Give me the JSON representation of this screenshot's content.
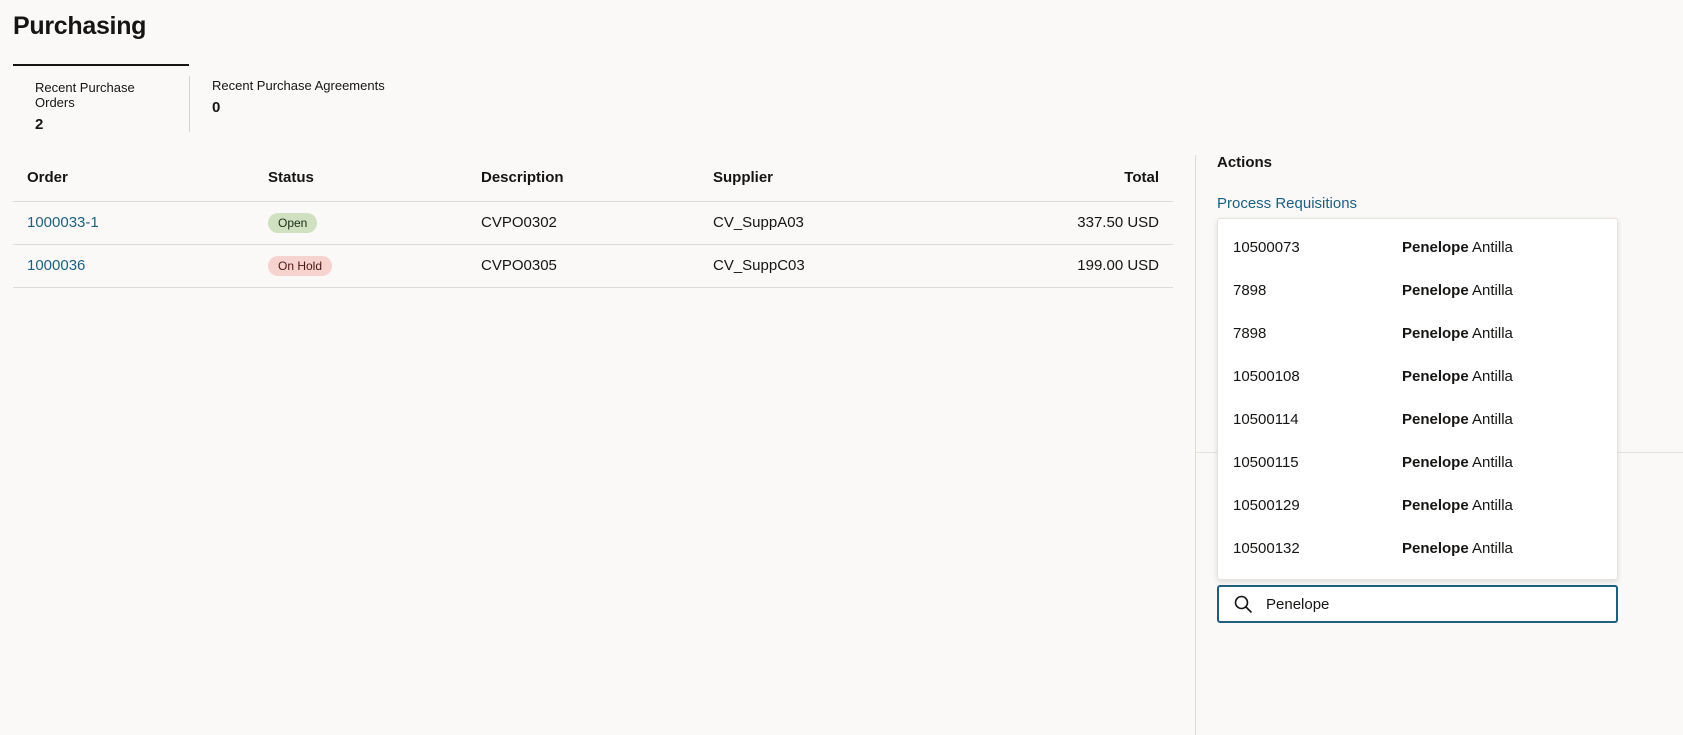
{
  "page": {
    "title": "Purchasing"
  },
  "tabs": [
    {
      "label": "Recent Purchase Orders",
      "count": "2"
    },
    {
      "label": "Recent Purchase Agreements",
      "count": "0"
    }
  ],
  "table": {
    "headers": {
      "order": "Order",
      "status": "Status",
      "description": "Description",
      "supplier": "Supplier",
      "total": "Total"
    },
    "rows": [
      {
        "order": "1000033-1",
        "status": "Open",
        "description": "CVPO0302",
        "supplier": "CV_SuppA03",
        "total": "337.50 USD"
      },
      {
        "order": "1000036",
        "status": "On Hold",
        "description": "CVPO0305",
        "supplier": "CV_SuppC03",
        "total": "199.00 USD"
      }
    ]
  },
  "actions": {
    "title": "Actions",
    "process_requisitions": "Process Requisitions"
  },
  "dropdown": {
    "items": [
      {
        "id": "10500073",
        "first": "Penelope",
        "last": "Antilla"
      },
      {
        "id": "7898",
        "first": "Penelope",
        "last": "Antilla"
      },
      {
        "id": "7898",
        "first": "Penelope",
        "last": "Antilla"
      },
      {
        "id": "10500108",
        "first": "Penelope",
        "last": "Antilla"
      },
      {
        "id": "10500114",
        "first": "Penelope",
        "last": "Antilla"
      },
      {
        "id": "10500115",
        "first": "Penelope",
        "last": "Antilla"
      },
      {
        "id": "10500129",
        "first": "Penelope",
        "last": "Antilla"
      },
      {
        "id": "10500132",
        "first": "Penelope",
        "last": "Antilla"
      }
    ]
  },
  "search": {
    "value": "Penelope",
    "icon": "search-icon"
  },
  "colors": {
    "link": "#1f5f7e",
    "open_badge": "#cfe1c0",
    "hold_badge": "#f7d3cf"
  }
}
